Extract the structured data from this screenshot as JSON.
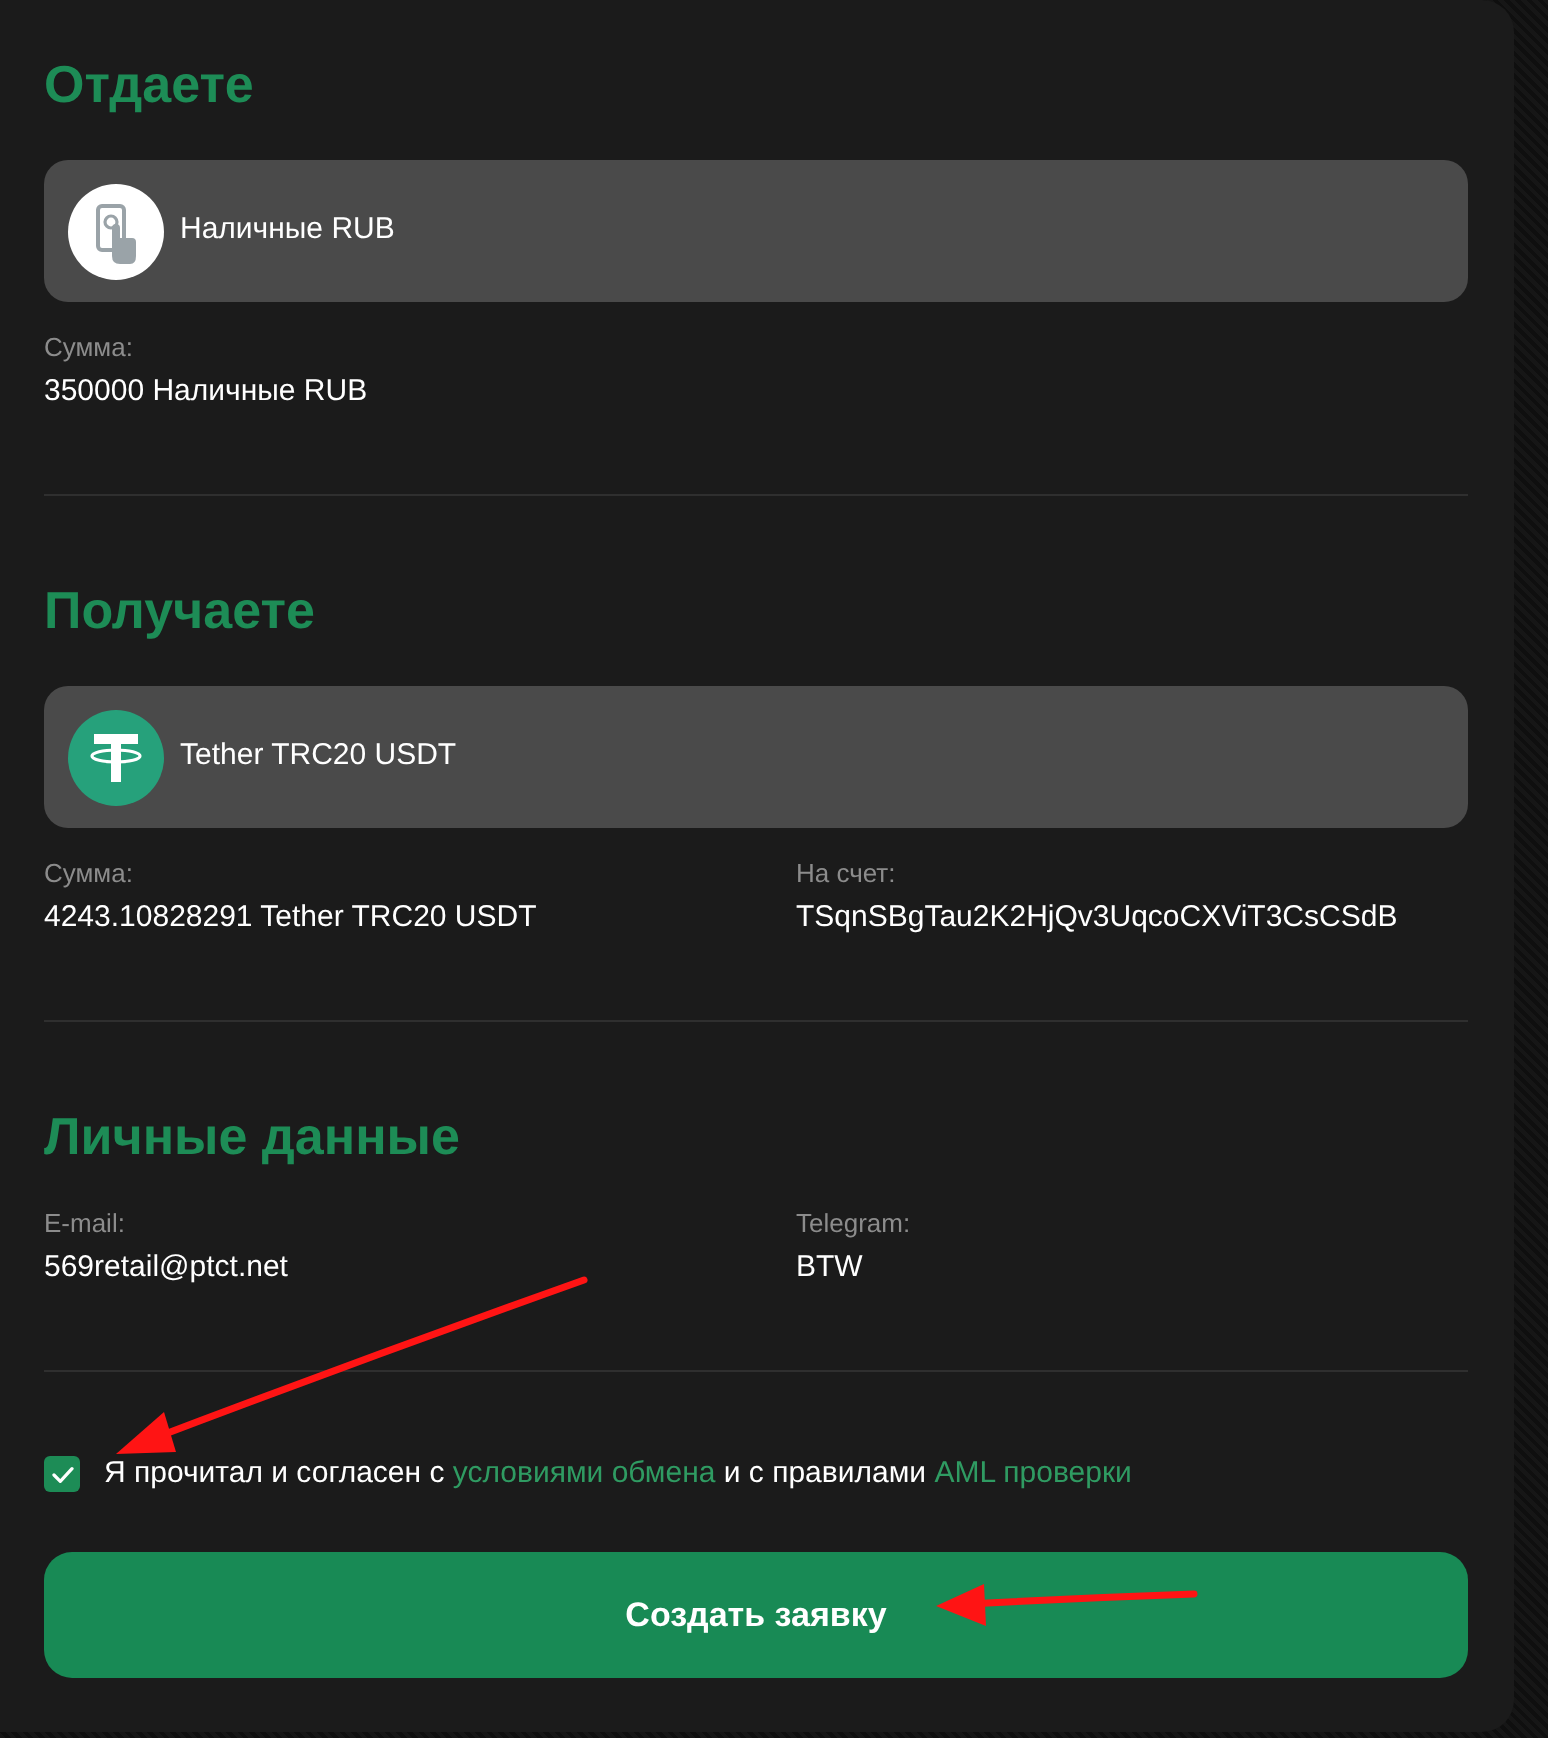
{
  "sections": [
    {
      "title": "Отдаете",
      "currency": {
        "kind": "cash",
        "name": "Наличные RUB"
      },
      "fields": [
        {
          "label": "Сумма:",
          "value": "350000 Наличные RUB"
        }
      ]
    },
    {
      "title": "Получаете",
      "currency": {
        "kind": "tether",
        "name": "Tether TRC20 USDT"
      },
      "fields": [
        {
          "label": "Сумма:",
          "value": "4243.10828291 Tether TRC20 USDT"
        },
        {
          "label": "На счет:",
          "value": "TSqnSBgTau2K2HjQv3UqcoCXViT3CsCSdB"
        }
      ]
    },
    {
      "title": "Личные данные",
      "fields": [
        {
          "label": "E-mail:",
          "value": "569retail@ptct.net"
        },
        {
          "label": "Telegram:",
          "value": "BTW"
        }
      ]
    }
  ],
  "agreement": {
    "checked": true,
    "parts": [
      {
        "kind": "text",
        "text": "Я прочитал и согласен с "
      },
      {
        "kind": "link",
        "text": "условиями обмена"
      },
      {
        "kind": "text",
        "text": " и с правилами "
      },
      {
        "kind": "link",
        "text": "AML проверки"
      }
    ]
  },
  "submit_button": {
    "label": "Создать заявку"
  }
}
